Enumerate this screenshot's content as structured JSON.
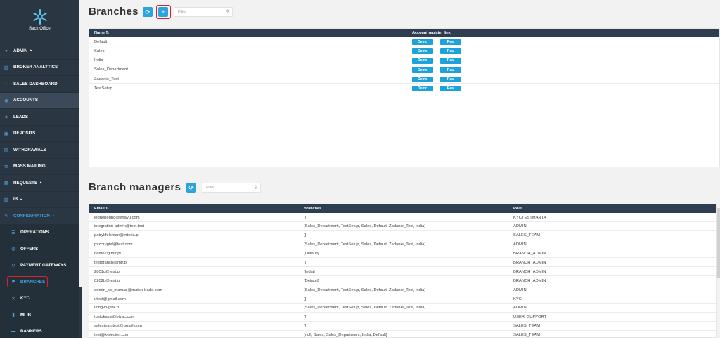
{
  "sidebar": {
    "logo_text": "Back Office",
    "items": [
      {
        "label": "ADMIN",
        "icon": "user-circle-icon",
        "caret": "▸"
      },
      {
        "label": "BROKER ANALYTICS",
        "icon": "chart-icon"
      },
      {
        "label": "SALES DASHBOARD",
        "icon": "dashboard-icon"
      },
      {
        "label": "ACCOUNTS",
        "icon": "users-icon"
      },
      {
        "label": "LEADS",
        "icon": "leads-icon"
      },
      {
        "label": "DEPOSITS",
        "icon": "deposit-icon"
      },
      {
        "label": "WITHDRAWALS",
        "icon": "withdraw-icon"
      },
      {
        "label": "MASS MAILING",
        "icon": "mail-icon"
      },
      {
        "label": "REQUESTS",
        "icon": "requests-icon",
        "caret": "▸"
      },
      {
        "label": "IB",
        "icon": "ib-icon",
        "caret": "▸"
      },
      {
        "label": "CONFIGURATION",
        "icon": "wrench-icon",
        "caret": "▴"
      },
      {
        "label": "OPERATIONS",
        "icon": "list-icon"
      },
      {
        "label": "OFFERS",
        "icon": "offers-icon"
      },
      {
        "label": "PAYMENT GATEWAYS",
        "icon": "gateway-icon"
      },
      {
        "label": "BRANCHES",
        "icon": "branch-icon"
      },
      {
        "label": "KYC",
        "icon": "kyc-icon"
      },
      {
        "label": "MLIB",
        "icon": "mlib-icon"
      },
      {
        "label": "BANNERS",
        "icon": "banner-icon"
      }
    ]
  },
  "branches": {
    "title": "Branches",
    "refresh_icon": "⟳",
    "add_icon": "+",
    "filter_placeholder": "Filter",
    "columns": {
      "name": "Name ⇅",
      "link": "Account register link"
    },
    "demo_label": "Demo",
    "real_label": "Real",
    "rows": [
      "Default",
      "Sales",
      "India",
      "Sales_Department",
      "Zadanie_Test",
      "TestSetup"
    ]
  },
  "managers": {
    "title": "Branch managers",
    "refresh_icon": "⟳",
    "filter_placeholder": "Filter",
    "columns": {
      "email": "Email ⇅",
      "branches": "Branches",
      "role": "Role"
    },
    "rows": [
      {
        "email": "jegnenegno@enayu.com",
        "branches": "[]",
        "role": "KYCTESTMARTA"
      },
      {
        "email": "integration-admin@test.test",
        "branches": "[Sales_Department, TestSetup, Sales, Default, Zadanie_Test, india]",
        "role": "ADMIN"
      },
      {
        "email": "patrykfelcman@interia.pl",
        "branches": "[]",
        "role": "SALES_TEAM"
      },
      {
        "email": "pszczygiel@test.com",
        "branches": "[Sales_Department, TestSetup, Sales, Default, Zadanie_Test, india]",
        "role": "ADMIN"
      },
      {
        "email": "demo2@mtr.pl",
        "branches": "[Default]",
        "role": "BRANCH_ADMIN"
      },
      {
        "email": "testbranch@mtr.pl",
        "branches": "[]",
        "role": "BRANCH_ADMIN"
      },
      {
        "email": "2801c@test.pl",
        "branches": "[India]",
        "role": "BRANCH_ADMIN"
      },
      {
        "email": "0202b@test.pl",
        "branches": "[Default]",
        "role": "BRANCH_ADMIN"
      },
      {
        "email": "admin_co_manual@match-trade.com",
        "branches": "[Sales_Department, TestSetup, Sales, Default, Zadanie_Test, india]",
        "role": "ADMIN"
      },
      {
        "email": "utest@gmail.com",
        "branches": "[]",
        "role": "KYC"
      },
      {
        "email": "vchgvo@bk.ru",
        "branches": "[Sales_Department, TestSetup, Sales, Default, Zadanie_Test, india]",
        "role": "ADMIN"
      },
      {
        "email": "tustokatre@biyac.com",
        "branches": "[]",
        "role": "USER_SUPPORT"
      },
      {
        "email": "salesteamtest@gmail.com",
        "branches": "[]",
        "role": "SALES_TEAM"
      },
      {
        "email": "test@kwiecien.com",
        "branches": "[null, Sales, Sales_Department, India, Default]",
        "role": "SALES_TEAM"
      }
    ]
  }
}
